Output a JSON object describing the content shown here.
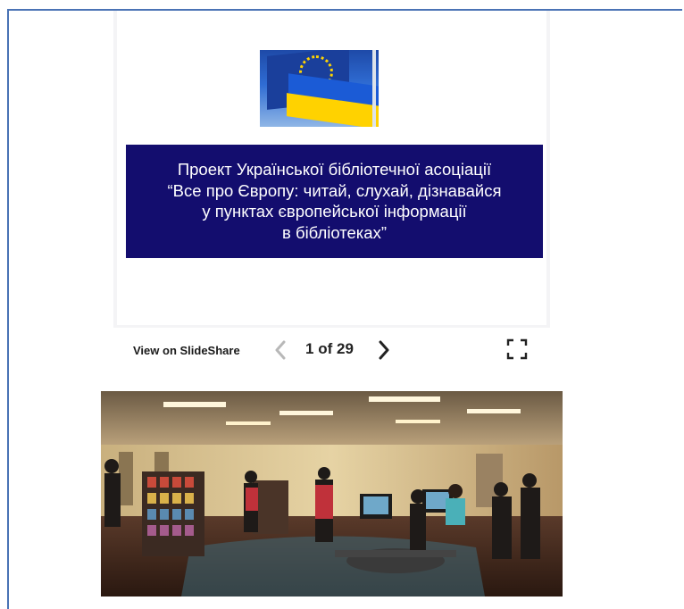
{
  "slide": {
    "line1": "Проект Української бібліотечної асоціації",
    "line2": "“Все про Європу: читай, слухай, дізнавайся",
    "line3": "у пунктах європейської інформації",
    "line4": "в бібліотеках”"
  },
  "toolbar": {
    "view_label": "View on SlideShare",
    "page_current": "1",
    "page_of": "of",
    "page_total": "29",
    "prev_icon": "chevron-left-icon",
    "next_icon": "chevron-right-icon",
    "fullscreen_icon": "fullscreen-icon"
  },
  "colors": {
    "frame_border": "#4a73b5",
    "banner_bg": "#130d6e",
    "banner_text": "#ffffff"
  }
}
